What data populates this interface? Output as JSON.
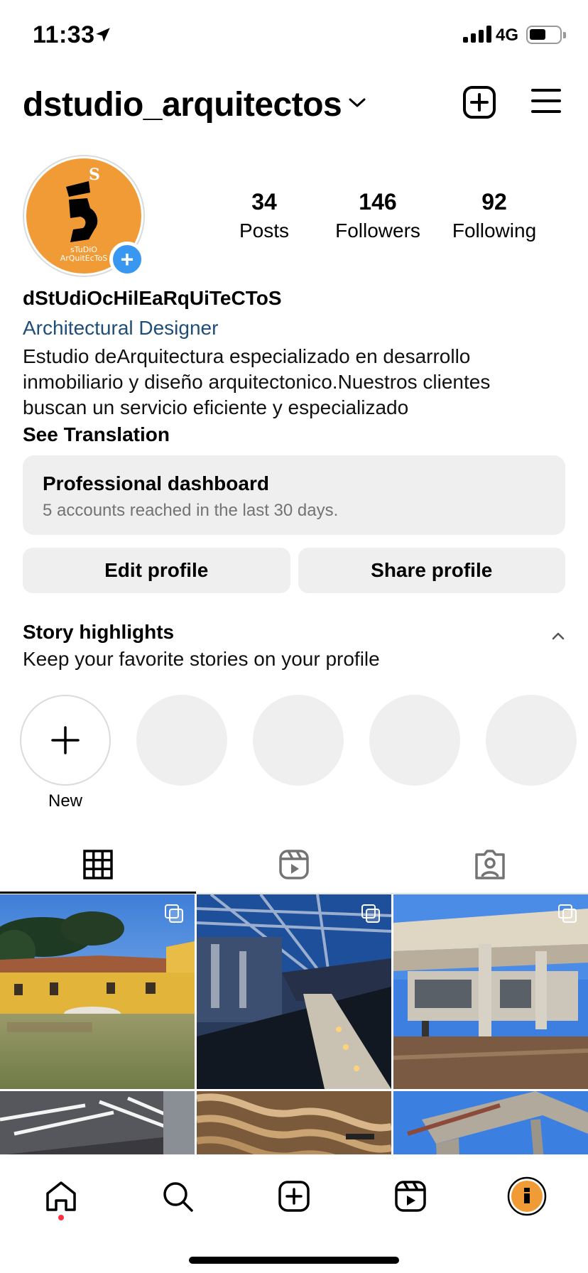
{
  "status_bar": {
    "time": "11:33",
    "network": "4G",
    "battery_level": 0.45
  },
  "header": {
    "username": "dstudio_arquitectos"
  },
  "profile": {
    "avatar_text": "sTuDiO ArQuitEcToS",
    "stats": [
      {
        "value": "34",
        "label": "Posts"
      },
      {
        "value": "146",
        "label": "Followers"
      },
      {
        "value": "92",
        "label": "Following"
      }
    ],
    "display_name": "dStUdiOcHilEaRqUiTeCToS",
    "category": "Architectural Designer",
    "bio_lines": [
      "Estudio deArquitectura especializado en desarrollo",
      "inmobiliario y diseño arquitectonico.Nuestros clientes",
      "buscan un servicio eficiente y especializado"
    ],
    "see_translation": "See Translation"
  },
  "dashboard": {
    "title": "Professional dashboard",
    "subtitle": "5 accounts reached in the last 30 days."
  },
  "buttons": {
    "edit_profile": "Edit profile",
    "share_profile": "Share profile"
  },
  "highlights": {
    "title": "Story highlights",
    "subtitle": "Keep your favorite stories on your profile",
    "new_label": "New"
  },
  "tabs": [
    "grid-icon",
    "reels-icon",
    "tagged-icon"
  ],
  "posts": [
    {
      "name": "yellow-house",
      "multi": true
    },
    {
      "name": "gym-interior",
      "multi": true
    },
    {
      "name": "concrete-building",
      "multi": true
    },
    {
      "name": "office-ceiling",
      "multi": false
    },
    {
      "name": "wood-ceiling",
      "multi": false
    },
    {
      "name": "concrete-frame",
      "multi": false
    }
  ],
  "colors": {
    "accent_blue": "#3897f0",
    "avatar_orange": "#f19b37",
    "category_blue": "#1f4e79",
    "notification_red": "#ff3040"
  }
}
